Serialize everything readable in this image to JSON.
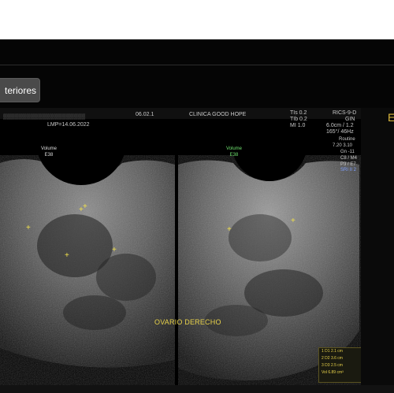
{
  "toolbar": {
    "button_label": "teriores"
  },
  "header": {
    "date_code": "06.02.1",
    "clinic": "CLINICA GOOD HOPE",
    "lmp": "LMP=14.06.2022",
    "tis": "TIs  0.2",
    "tib": "TIb  0.2",
    "mi": "MI  1.0",
    "probe": "RICS-9-D",
    "preset": "GIN",
    "depth": "6.0cm / 1.2",
    "angle": "165°/ 46Hz",
    "mode": "Routine",
    "freq": "7.20  3.10",
    "gain": "Gn  -11",
    "cb": "C8 / M4",
    "p": "P3 / E7",
    "sri": "SRI II 2"
  },
  "panels": {
    "left_mark": "Volume\nE38",
    "right_mark": "Volume\nE38"
  },
  "annotation": {
    "text": "OVARIO DERECHO"
  },
  "measurements": [
    "1  D1    2.1 cm",
    "2  D2    3.6 cm",
    "3  D3    2.5 cm",
    "Vol 6.89 cm³"
  ],
  "right_panel": {
    "letter": "E"
  }
}
